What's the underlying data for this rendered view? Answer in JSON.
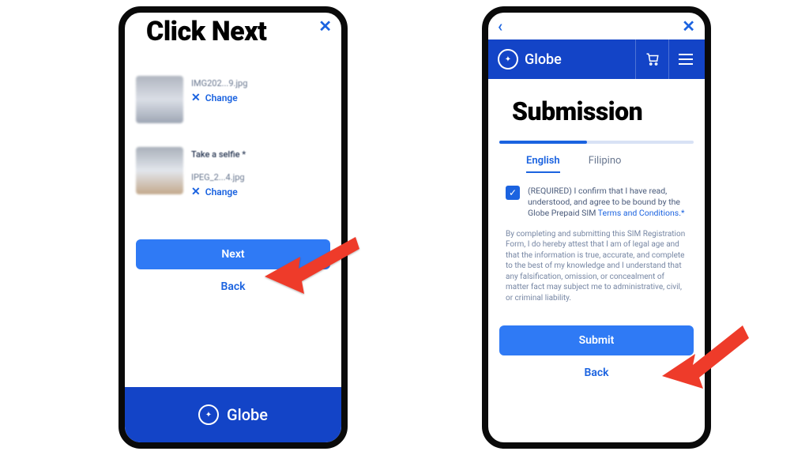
{
  "labels": {
    "left": "Click Next",
    "right": "Submission"
  },
  "brand": "Globe",
  "left": {
    "close": "✕",
    "upload1_label": "",
    "upload1_file": "IMG202...9.jpg",
    "change": "Change",
    "upload2_label": "Take a selfie *",
    "upload2_file": "IPEG_2...4.jpg",
    "next": "Next",
    "back": "Back",
    "footer_brand": "Globe"
  },
  "right": {
    "back_caret": "‹",
    "close": "✕",
    "tabs": {
      "english": "English",
      "filipino": "Filipino"
    },
    "checkbox_glyph": "✓",
    "consent_required": "(REQUIRED) I confirm that I have read, understood, and agree to be bound by the Globe Prepaid SIM ",
    "consent_link": "Terms and Conditions.*",
    "disclaimer": "By completing and submitting this SIM Registration Form, I do hereby attest that I am of legal age and that the information is true, accurate, and complete to the best of my knowledge and I understand that any falsification, omission, or concealment of matter fact may subject me to administrative, civil, or criminal liability.",
    "submit": "Submit",
    "back": "Back"
  }
}
